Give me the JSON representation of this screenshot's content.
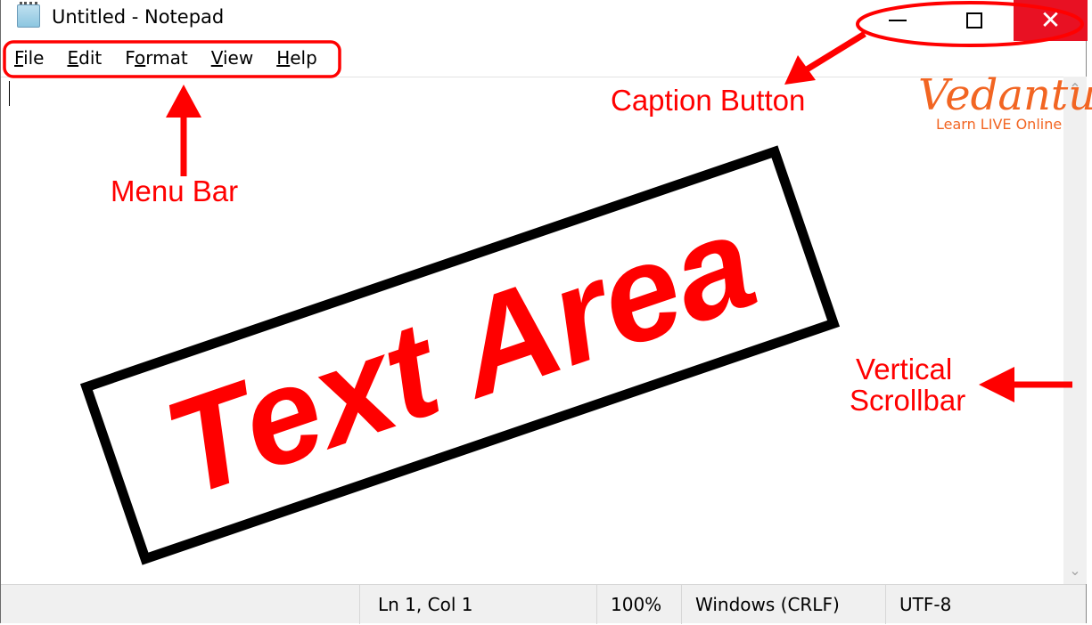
{
  "window": {
    "title": "Untitled - Notepad",
    "icon": "notepad-icon"
  },
  "caption_buttons": {
    "minimize": "minimize-icon",
    "maximize": "maximize-icon",
    "close": "✕",
    "close_color": "#e81123"
  },
  "menu": [
    {
      "accel": "F",
      "rest": "ile"
    },
    {
      "accel": "E",
      "rest": "dit"
    },
    {
      "pre": "F",
      "accel": "o",
      "rest": "rmat"
    },
    {
      "accel": "V",
      "rest": "iew"
    },
    {
      "accel": "H",
      "rest": "elp"
    }
  ],
  "status_bar": {
    "position": "Ln 1, Col 1",
    "zoom": "100%",
    "line_ending": "Windows (CRLF)",
    "encoding": "UTF-8"
  },
  "annotations": {
    "caption_button": "Caption Button",
    "menu_bar": "Menu Bar",
    "text_area": "Text Area",
    "scrollbar_line1": "Vertical",
    "scrollbar_line2": "Scrollbar",
    "color": "#ff0000"
  },
  "logo": {
    "name": "Vedantu",
    "tagline": "Learn LIVE Online",
    "color": "#f26522"
  }
}
